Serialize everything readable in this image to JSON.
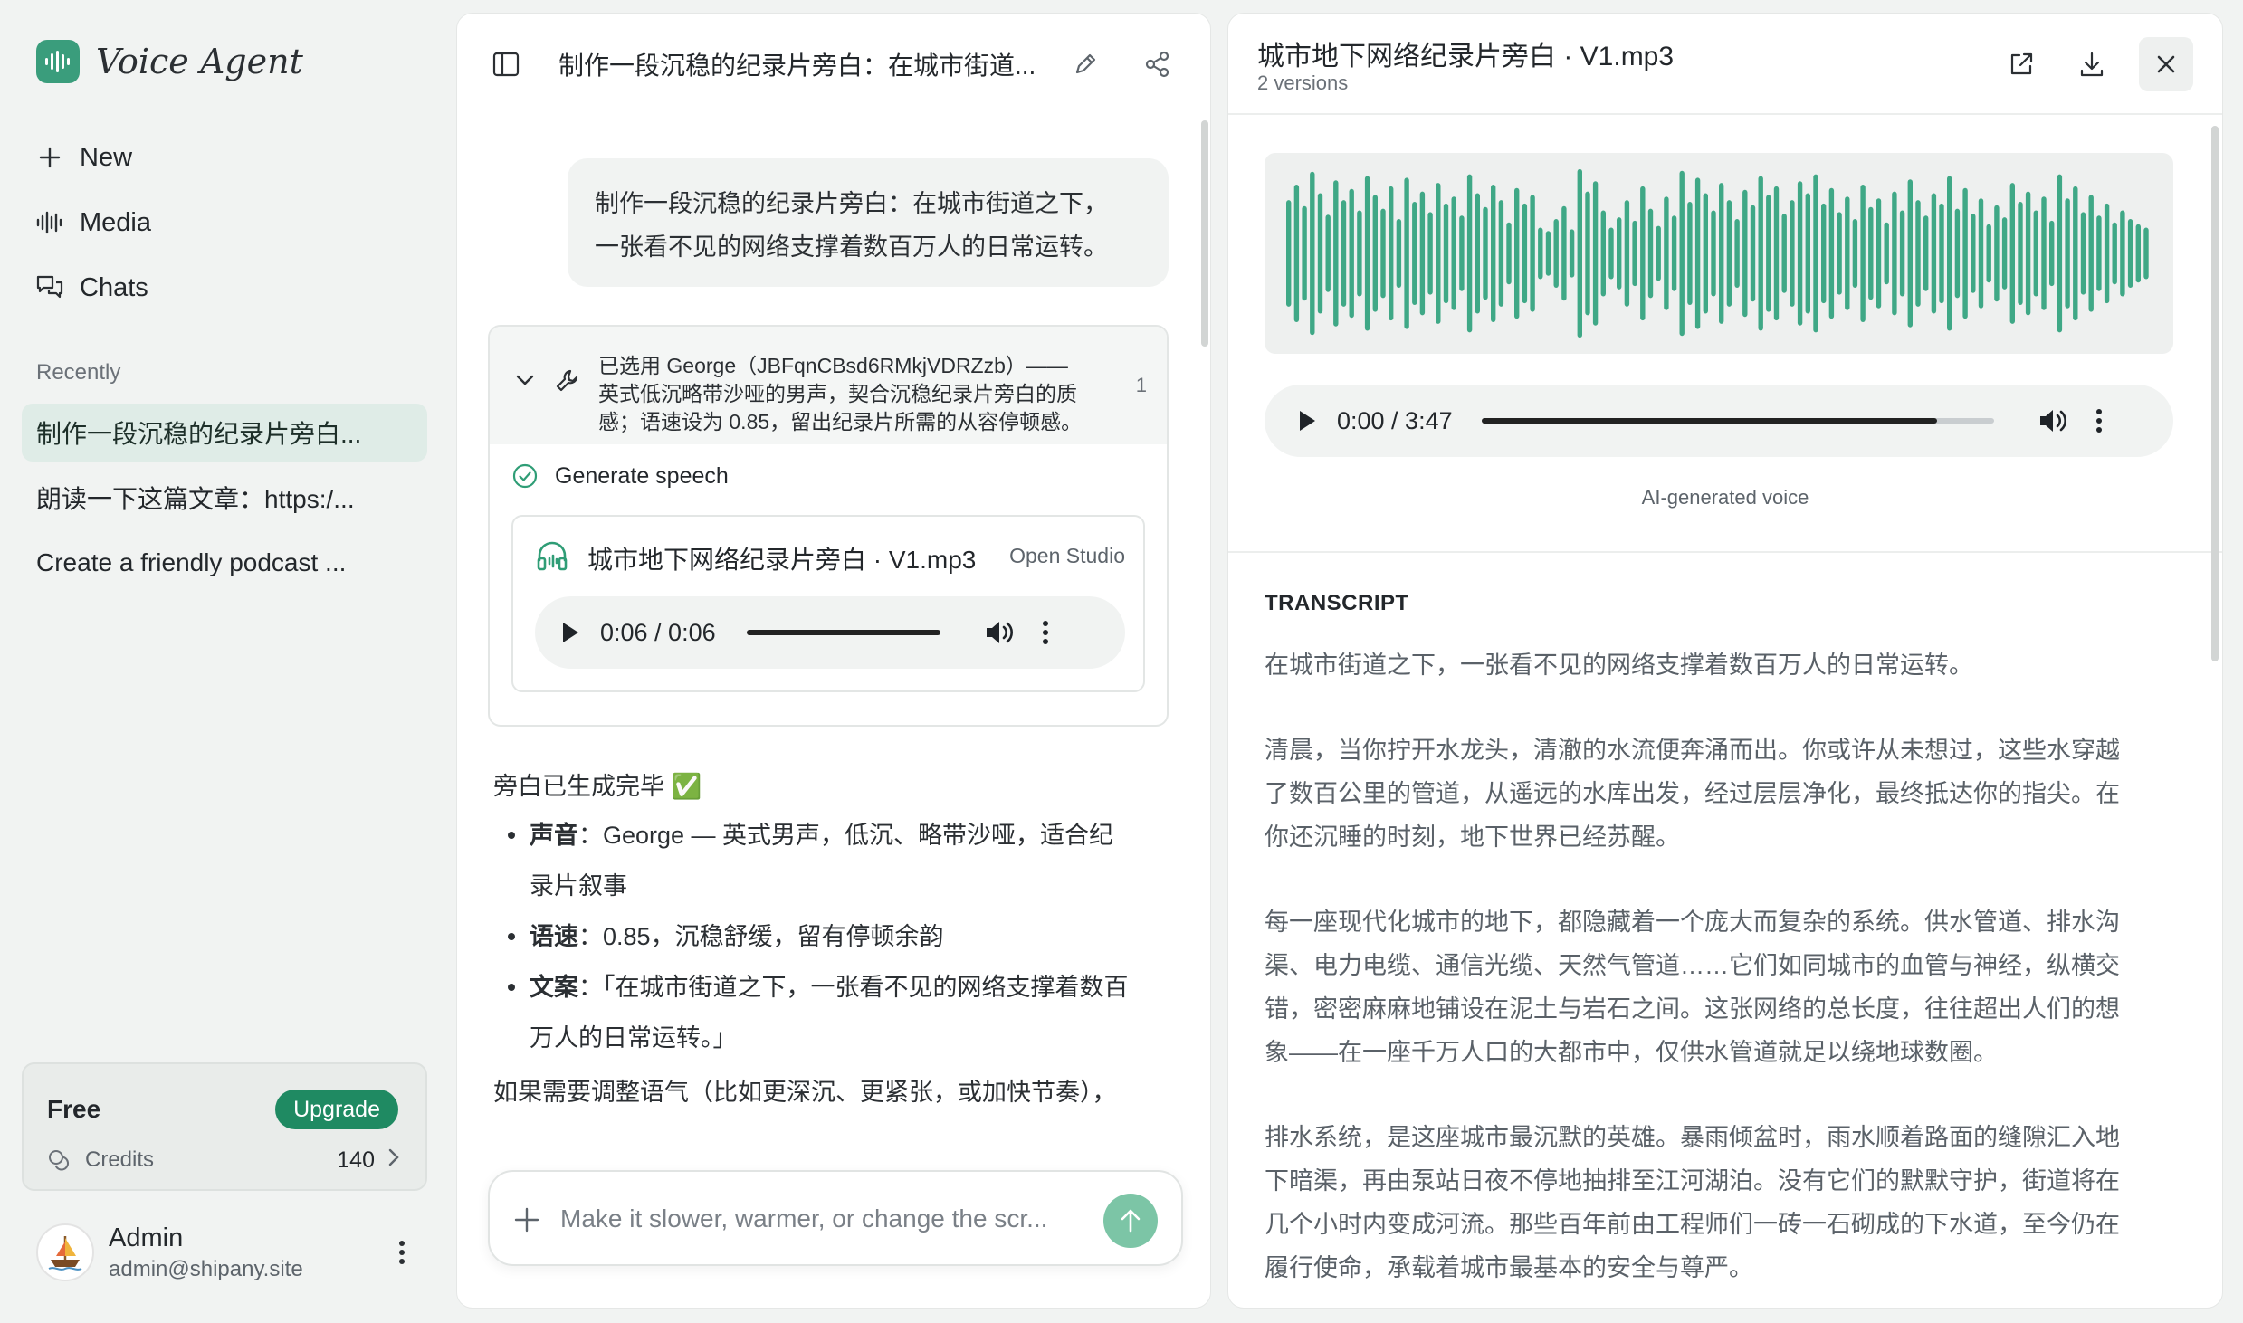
{
  "sidebar": {
    "brand": "Voice Agent",
    "nav": [
      {
        "label": "New",
        "icon": "plus-icon"
      },
      {
        "label": "Media",
        "icon": "audio-bars-icon"
      },
      {
        "label": "Chats",
        "icon": "chat-bubbles-icon"
      }
    ],
    "recent_label": "Recently",
    "recent": [
      "制作一段沉稳的纪录片旁白...",
      "朗读一下这篇文章：https:/...",
      "Create a friendly podcast ..."
    ],
    "plan": {
      "name": "Free",
      "upgrade_label": "Upgrade",
      "credits_label": "Credits",
      "credits_value": "140"
    },
    "user": {
      "name": "Admin",
      "email": "admin@shipany.site"
    }
  },
  "chat": {
    "title": "制作一段沉稳的纪录片旁白：在城市街道...",
    "user_message_line1": "制作一段沉稳的纪录片旁白：在城市街道之下，",
    "user_message_line2": "一张看不见的网络支撑着数百万人的日常运转。",
    "tool_line1": "已选用 George（JBFqnCBsd6RMkjVDRZzb）——",
    "tool_line2": "英式低沉略带沙哑的男声，契合沉稳纪录片旁白的质",
    "tool_line3": "感；语速设为 0.85，留出纪录片所需的从容停顿感。",
    "tool_count": "1",
    "generate_label": "Generate speech",
    "audio_title": "城市地下网络纪录片旁白 · V1.mp3",
    "open_studio": "Open Studio",
    "audio_time": "0:06 / 0:06",
    "audio_progress": 1.0,
    "reply_intro": "旁白已生成完毕 ✅",
    "bullets": [
      {
        "key": "声音",
        "sep": "：",
        "line1": "George — 英式男声，低沉、略带沙哑，适合纪",
        "line2": "录片叙事"
      },
      {
        "key": "语速",
        "sep": "：",
        "line1": "0.85，沉稳舒缓，留有停顿余韵",
        "line2": ""
      },
      {
        "key": "文案",
        "sep": "：",
        "line1": "「在城市街道之下，一张看不见的网络支撑着数百",
        "line2": "万人的日常运转。」"
      }
    ],
    "reply_outro": "如果需要调整语气（比如更深沉、更紧张，或加快节奏），",
    "input_placeholder": "Make it slower, warmer, or change the scr..."
  },
  "panel": {
    "title": "城市地下网络纪录片旁白 · V1.mp3",
    "versions": "2 versions",
    "player_time": "0:00 / 3:47",
    "player_progress": 0.89,
    "ai_label": "AI-generated voice",
    "transcript_label": "TRANSCRIPT",
    "paragraphs": [
      [
        "在城市街道之下，一张看不见的网络支撑着数百万人的日常运转。"
      ],
      [
        "清晨，当你拧开水龙头，清澈的水流便奔涌而出。你或许从未想过，这些水穿越",
        "了数百公里的管道，从遥远的水库出发，经过层层净化，最终抵达你的指尖。在",
        "你还沉睡的时刻，地下世界已经苏醒。"
      ],
      [
        "每一座现代化城市的地下，都隐藏着一个庞大而复杂的系统。供水管道、排水沟",
        "渠、电力电缆、通信光缆、天然气管道……它们如同城市的血管与神经，纵横交",
        "错，密密麻麻地铺设在泥土与岩石之间。这张网络的总长度，往往超出人们的想",
        "象——在一座千万人口的大都市中，仅供水管道就足以绕地球数圈。"
      ],
      [
        "排水系统，是这座城市最沉默的英雄。暴雨倾盆时，雨水顺着路面的缝隙汇入地",
        "下暗渠，再由泵站日夜不停地抽排至江河湖泊。没有它们的默默守护，街道将在",
        "几个小时内变成河流。那些百年前由工程师们一砖一石砌成的下水道，至今仍在",
        "履行使命，承载着城市最基本的安全与尊严。"
      ]
    ],
    "waveform": [
      0.62,
      0.8,
      0.55,
      0.95,
      0.7,
      0.45,
      0.85,
      0.62,
      0.75,
      0.5,
      0.9,
      0.68,
      0.52,
      0.78,
      0.4,
      0.88,
      0.6,
      0.72,
      0.48,
      0.82,
      0.58,
      0.66,
      0.44,
      0.92,
      0.7,
      0.54,
      0.8,
      0.62,
      0.36,
      0.76,
      0.58,
      0.68,
      0.3,
      0.26,
      0.4,
      0.55,
      0.28,
      0.98,
      0.72,
      0.84,
      0.5,
      0.3,
      0.42,
      0.62,
      0.38,
      0.78,
      0.52,
      0.32,
      0.66,
      0.44,
      0.96,
      0.6,
      0.88,
      0.7,
      0.5,
      0.82,
      0.62,
      0.4,
      0.74,
      0.56,
      0.9,
      0.68,
      0.78,
      0.46,
      0.62,
      0.84,
      0.7,
      0.92,
      0.58,
      0.76,
      0.48,
      0.66,
      0.4,
      0.8,
      0.54,
      0.64,
      0.36,
      0.72,
      0.5,
      0.86,
      0.62,
      0.44,
      0.7,
      0.58,
      0.9,
      0.52,
      0.76,
      0.46,
      0.64,
      0.34,
      0.56,
      0.42,
      0.82,
      0.6,
      0.72,
      0.5,
      0.66,
      0.38,
      0.92,
      0.64,
      0.78,
      0.48,
      0.68,
      0.44,
      0.58,
      0.36,
      0.5,
      0.4,
      0.34,
      0.3
    ],
    "accent": "#3fa886"
  }
}
